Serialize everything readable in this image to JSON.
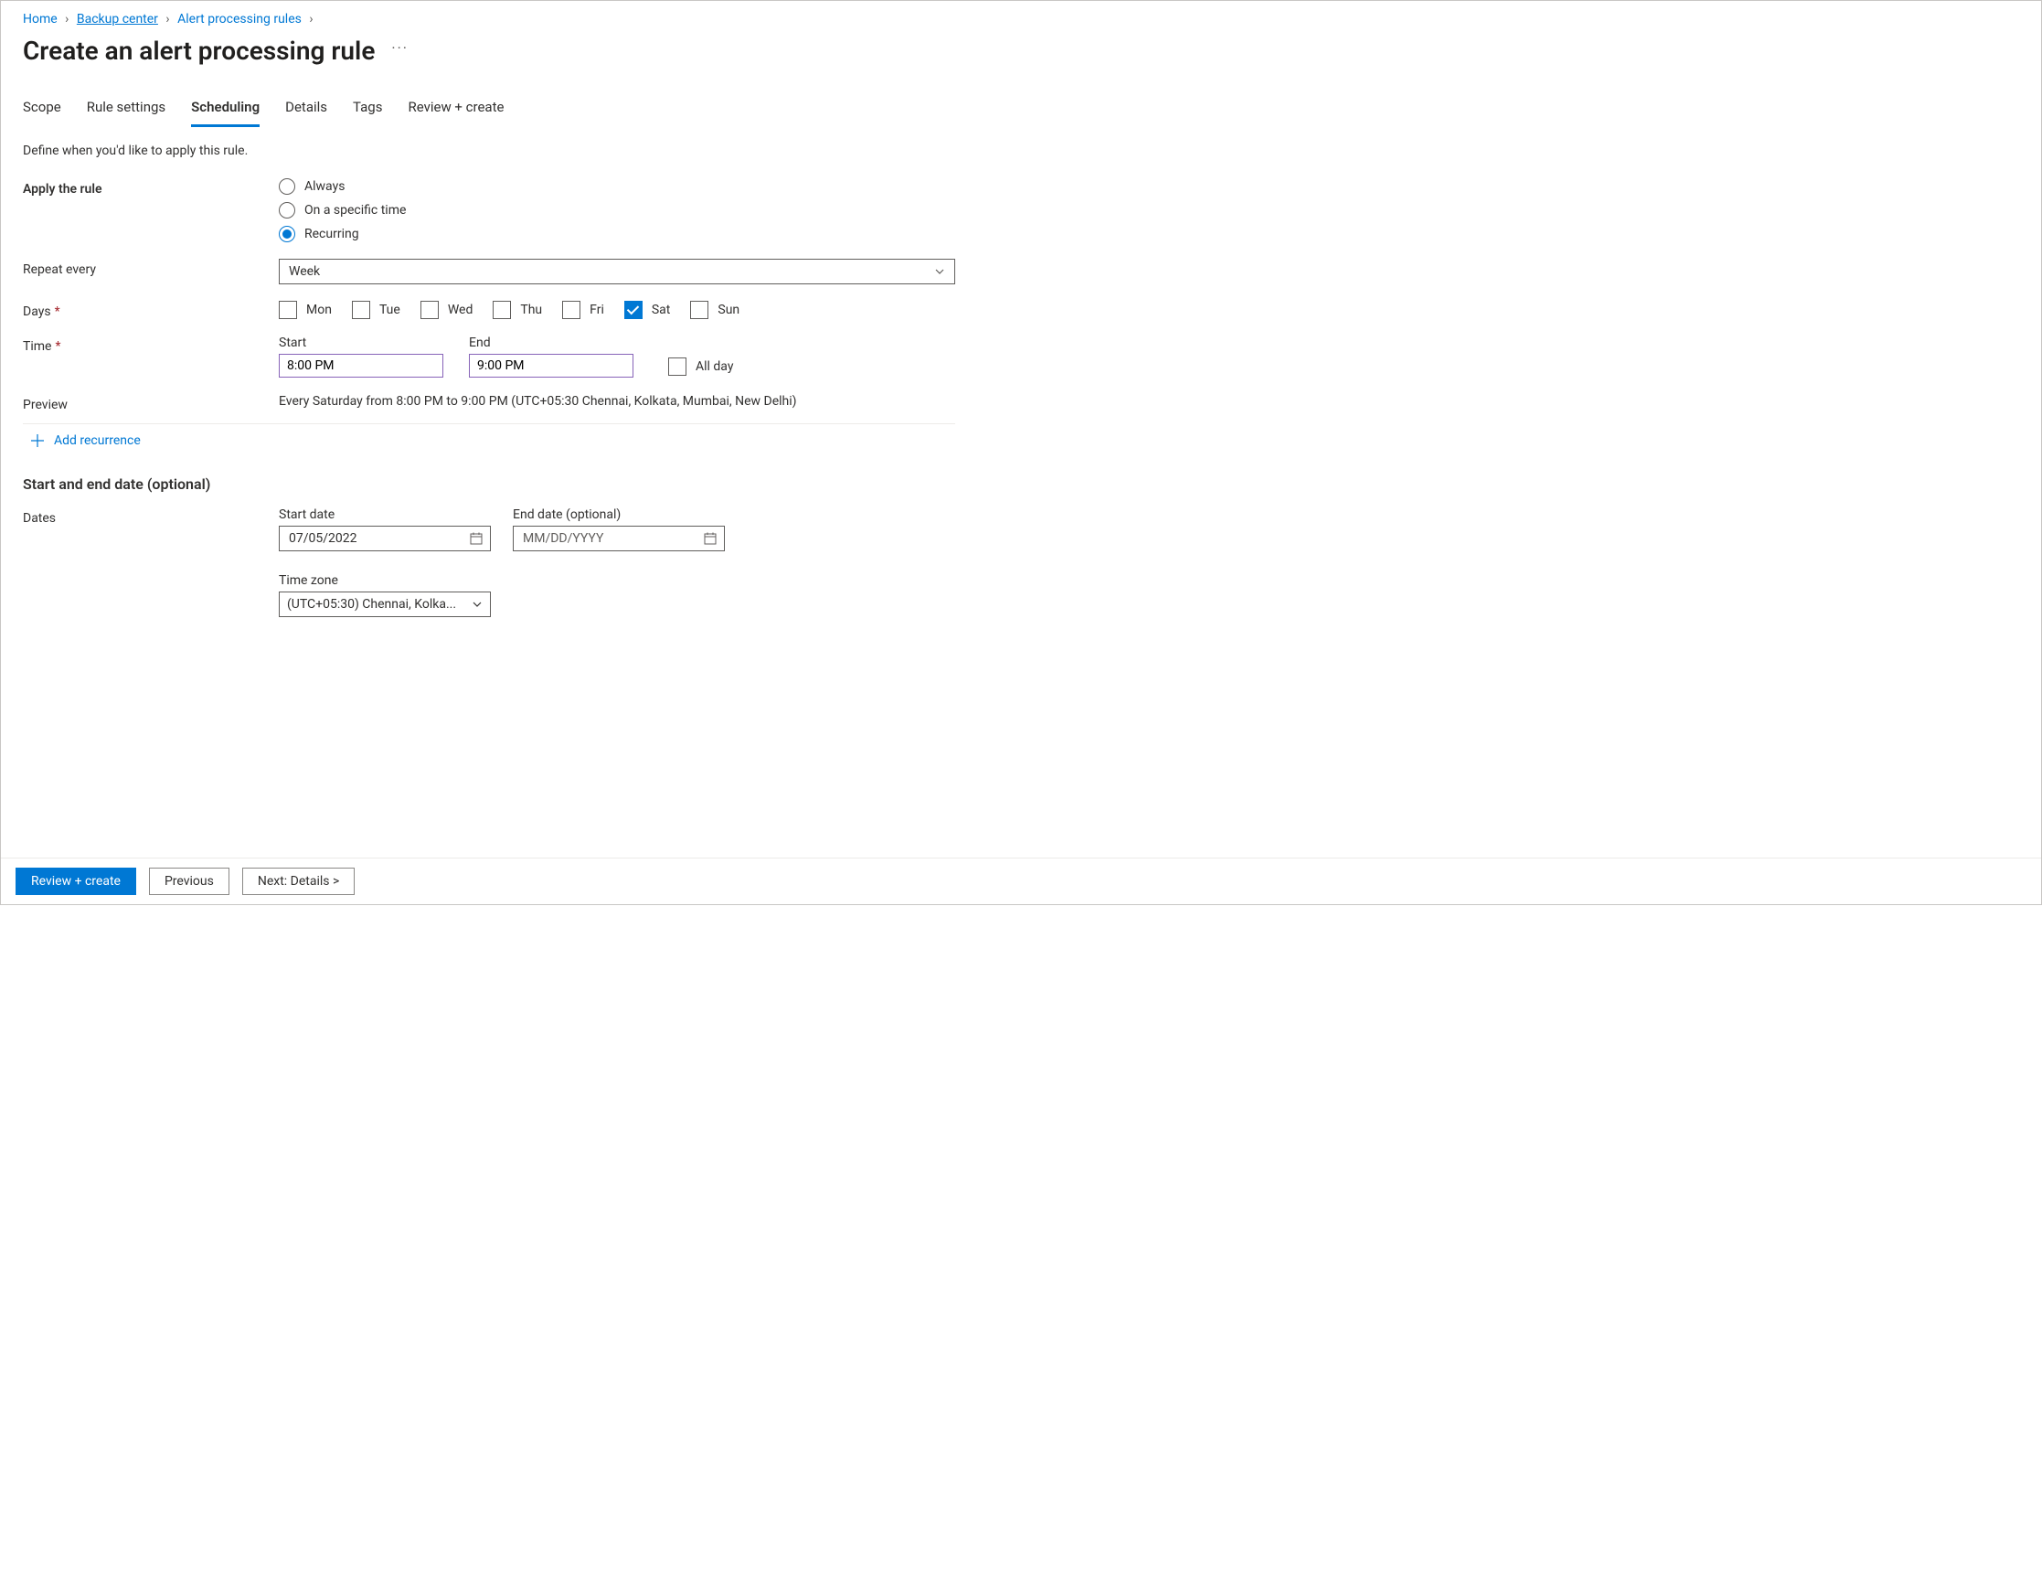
{
  "breadcrumb": {
    "items": [
      "Home",
      "Backup center",
      "Alert processing rules"
    ]
  },
  "title": "Create an alert processing rule",
  "tabs": [
    "Scope",
    "Rule settings",
    "Scheduling",
    "Details",
    "Tags",
    "Review + create"
  ],
  "activeTab": "Scheduling",
  "sectionDesc": "Define when you'd like to apply this rule.",
  "labels": {
    "applyRule": "Apply the rule",
    "repeatEvery": "Repeat every",
    "days": "Days",
    "time": "Time",
    "start": "Start",
    "end": "End",
    "allDay": "All day",
    "preview": "Preview",
    "addRecurrence": "Add recurrence",
    "datesHeading": "Start and end date (optional)",
    "dates": "Dates",
    "startDate": "Start date",
    "endDate": "End date (optional)",
    "timeZone": "Time zone"
  },
  "radios": {
    "always": "Always",
    "specific": "On a specific time",
    "recurring": "Recurring",
    "selected": "recurring"
  },
  "repeatSelect": {
    "value": "Week"
  },
  "days": {
    "options": [
      "Mon",
      "Tue",
      "Wed",
      "Thu",
      "Fri",
      "Sat",
      "Sun"
    ],
    "checked": [
      "Sat"
    ]
  },
  "time": {
    "start": "8:00 PM",
    "end": "9:00 PM",
    "allDay": false
  },
  "previewText": "Every Saturday from 8:00 PM to 9:00 PM (UTC+05:30 Chennai, Kolkata, Mumbai, New Delhi)",
  "datesSection": {
    "startDate": "07/05/2022",
    "endDatePlaceholder": "MM/DD/YYYY",
    "timeZone": "(UTC+05:30) Chennai, Kolka..."
  },
  "footer": {
    "review": "Review + create",
    "previous": "Previous",
    "next": "Next: Details >"
  }
}
